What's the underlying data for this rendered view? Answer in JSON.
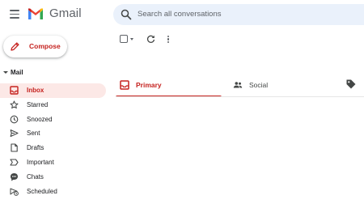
{
  "header": {
    "app_name": "Gmail",
    "search_placeholder": "Search all conversations"
  },
  "compose": {
    "label": "Compose"
  },
  "sidebar": {
    "section_label": "Mail",
    "items": [
      {
        "label": "Inbox",
        "icon": "inbox-icon",
        "active": true
      },
      {
        "label": "Starred",
        "icon": "star-icon",
        "active": false
      },
      {
        "label": "Snoozed",
        "icon": "clock-icon",
        "active": false
      },
      {
        "label": "Sent",
        "icon": "send-icon",
        "active": false
      },
      {
        "label": "Drafts",
        "icon": "draft-icon",
        "active": false
      },
      {
        "label": "Important",
        "icon": "important-icon",
        "active": false
      },
      {
        "label": "Chats",
        "icon": "chat-icon",
        "active": false
      },
      {
        "label": "Scheduled",
        "icon": "scheduled-icon",
        "active": false
      }
    ]
  },
  "tabs": [
    {
      "label": "Primary",
      "icon": "inbox-tab-icon",
      "active": true
    },
    {
      "label": "Social",
      "icon": "people-icon",
      "active": false
    }
  ],
  "colors": {
    "accent": "#c5221f",
    "active_bg": "#fce8e6",
    "search_bg": "#eaf1fb",
    "icon_gray": "#5f6368"
  }
}
